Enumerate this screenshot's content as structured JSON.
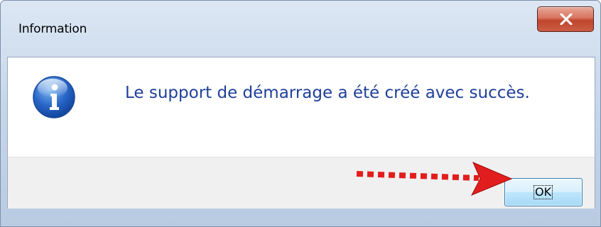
{
  "window": {
    "title": "Information"
  },
  "titlebar": {
    "close_button_icon": "close-x-icon"
  },
  "dialog": {
    "icon": "info-icon",
    "message": "Le support de démarrage a été créé avec succès.",
    "ok_label": "OK"
  },
  "annotation": {
    "icon": "red-dotted-arrow-icon",
    "color": "#e21d1d"
  },
  "colors": {
    "message_text": "#1f3f9a",
    "close_button": "#c95d42",
    "ok_button_border": "#3c7fb1"
  }
}
